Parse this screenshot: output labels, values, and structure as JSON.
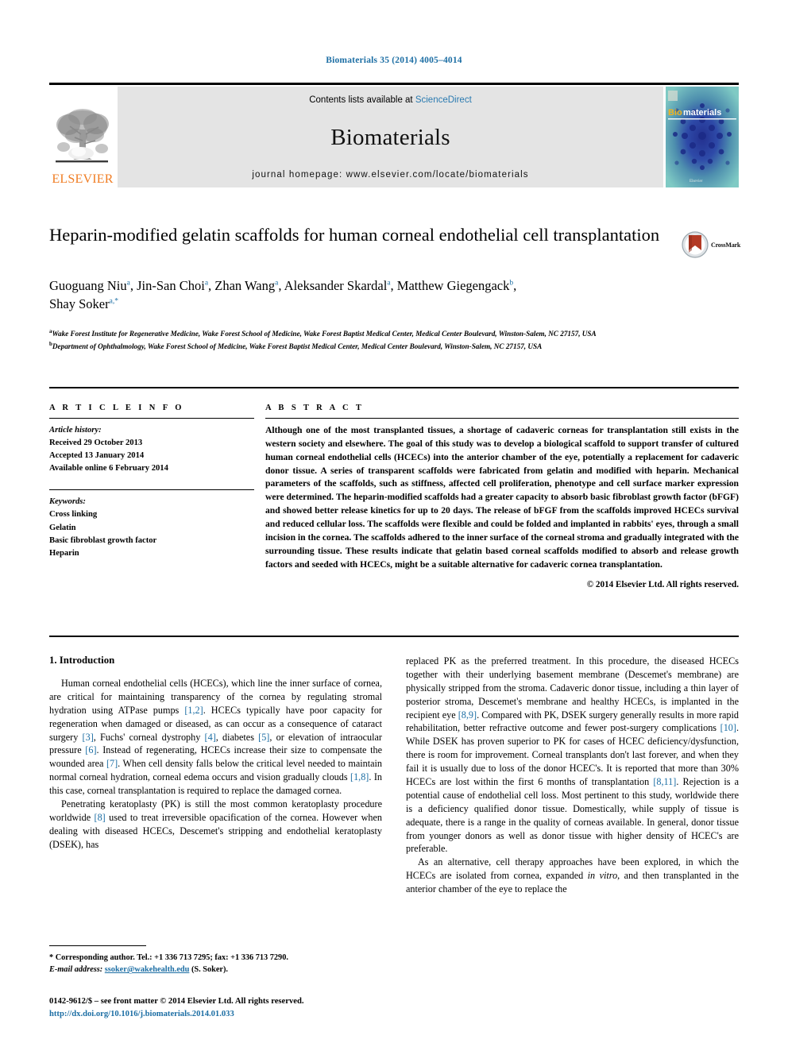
{
  "running_head": "Biomaterials 35 (2014) 4005–4014",
  "masthead": {
    "publisher_name": "ELSEVIER",
    "contents_prefix": "Contents lists available at ",
    "contents_link": "ScienceDirect",
    "journal_name": "Biomaterials",
    "homepage": "journal homepage: www.elsevier.com/locate/biomaterials",
    "cover_title_prefix": "Bio",
    "cover_title_suffix": "materials"
  },
  "article": {
    "title": "Heparin-modified gelatin scaffolds for human corneal endothelial cell transplantation",
    "crossmark_label": "CrossMark",
    "authors_line1": "Guoguang Niu a, Jin-San Choi a, Zhan Wang a, Aleksander Skardal a, Matthew Giegengack b,",
    "authors_line2": "Shay Soker a,*",
    "authors": [
      {
        "name": "Guoguang Niu",
        "sup": "a"
      },
      {
        "name": "Jin-San Choi",
        "sup": "a"
      },
      {
        "name": "Zhan Wang",
        "sup": "a"
      },
      {
        "name": "Aleksander Skardal",
        "sup": "a"
      },
      {
        "name": "Matthew Giegengack",
        "sup": "b"
      },
      {
        "name": "Shay Soker",
        "sup": "a,*"
      }
    ],
    "affiliations": [
      {
        "marker": "a",
        "text": "Wake Forest Institute for Regenerative Medicine, Wake Forest School of Medicine, Wake Forest Baptist Medical Center, Medical Center Boulevard, Winston-Salem, NC 27157, USA"
      },
      {
        "marker": "b",
        "text": "Department of Ophthalmology, Wake Forest School of Medicine, Wake Forest Baptist Medical Center, Medical Center Boulevard, Winston-Salem, NC 27157, USA"
      }
    ]
  },
  "article_info": {
    "heading": "A R T I C L E  I N F O",
    "history_label": "Article history:",
    "history": [
      "Received 29 October 2013",
      "Accepted 13 January 2014",
      "Available online 6 February 2014"
    ],
    "keywords_label": "Keywords:",
    "keywords": [
      "Cross linking",
      "Gelatin",
      "Basic fibroblast growth factor",
      "Heparin"
    ]
  },
  "abstract": {
    "heading": "A B S T R A C T",
    "text": "Although one of the most transplanted tissues, a shortage of cadaveric corneas for transplantation still exists in the western society and elsewhere. The goal of this study was to develop a biological scaffold to support transfer of cultured human corneal endothelial cells (HCECs) into the anterior chamber of the eye, potentially a replacement for cadaveric donor tissue. A series of transparent scaffolds were fabricated from gelatin and modified with heparin. Mechanical parameters of the scaffolds, such as stiffness, affected cell proliferation, phenotype and cell surface marker expression were determined. The heparin-modified scaffolds had a greater capacity to absorb basic fibroblast growth factor (bFGF) and showed better release kinetics for up to 20 days. The release of bFGF from the scaffolds improved HCECs survival and reduced cellular loss. The scaffolds were flexible and could be folded and implanted in rabbits' eyes, through a small incision in the cornea. The scaffolds adhered to the inner surface of the corneal stroma and gradually integrated with the surrounding tissue. These results indicate that gelatin based corneal scaffolds modified to absorb and release growth factors and seeded with HCECs, might be a suitable alternative for cadaveric cornea transplantation.",
    "copyright": "© 2014 Elsevier Ltd. All rights reserved."
  },
  "body": {
    "section_heading": "1. Introduction",
    "left_paragraphs": [
      "Human corneal endothelial cells (HCECs), which line the inner surface of cornea, are critical for maintaining transparency of the cornea by regulating stromal hydration using ATPase pumps [1,2]. HCECs typically have poor capacity for regeneration when damaged or diseased, as can occur as a consequence of cataract surgery [3], Fuchs' corneal dystrophy [4], diabetes [5], or elevation of intraocular pressure [6]. Instead of regenerating, HCECs increase their size to compensate the wounded area [7]. When cell density falls below the critical level needed to maintain normal corneal hydration, corneal edema occurs and vision gradually clouds [1,8]. In this case, corneal transplantation is required to replace the damaged cornea.",
      "Penetrating keratoplasty (PK) is still the most common keratoplasty procedure worldwide [8] used to treat irreversible opacification of the cornea. However when dealing with diseased HCECs, Descemet's stripping and endothelial keratoplasty (DSEK), has"
    ],
    "right_paragraphs": [
      "replaced PK as the preferred treatment. In this procedure, the diseased HCECs together with their underlying basement membrane (Descemet's membrane) are physically stripped from the stroma. Cadaveric donor tissue, including a thin layer of posterior stroma, Descemet's membrane and healthy HCECs, is implanted in the recipient eye [8,9]. Compared with PK, DSEK surgery generally results in more rapid rehabilitation, better refractive outcome and fewer post-surgery complications [10]. While DSEK has proven superior to PK for cases of HCEC deficiency/dysfunction, there is room for improvement. Corneal transplants don't last forever, and when they fail it is usually due to loss of the donor HCEC's. It is reported that more than 30% HCECs are lost within the first 6 months of transplantation [8,11]. Rejection is a potential cause of endothelial cell loss. Most pertinent to this study, worldwide there is a deficiency qualified donor tissue. Domestically, while supply of tissue is adequate, there is a range in the quality of corneas available. In general, donor tissue from younger donors as well as donor tissue with higher density of HCEC's are preferable.",
      "As an alternative, cell therapy approaches have been explored, in which the HCECs are isolated from cornea, expanded in vitro, and then transplanted in the anterior chamber of the eye to replace the"
    ]
  },
  "footnote": {
    "corresponding": "* Corresponding author. Tel.: +1 336 713 7295; fax: +1 336 713 7290.",
    "email_label": "E-mail address:",
    "email": "ssoker@wakehealth.edu",
    "email_suffix": "(S. Soker)."
  },
  "frontmatter": {
    "line1": "0142-9612/$ – see front matter © 2014 Elsevier Ltd. All rights reserved.",
    "doi": "http://dx.doi.org/10.1016/j.biomaterials.2014.01.033"
  },
  "colors": {
    "link_blue": "#1c6ea4",
    "sciencedirect_blue": "#2a7ab0",
    "elsevier_orange": "#f07c22",
    "band_gray": "#e4e4e4",
    "cover_teal": "#6fc2c2",
    "cover_blue": "#2b3f9e",
    "crossmark_red": "#b33a25"
  }
}
